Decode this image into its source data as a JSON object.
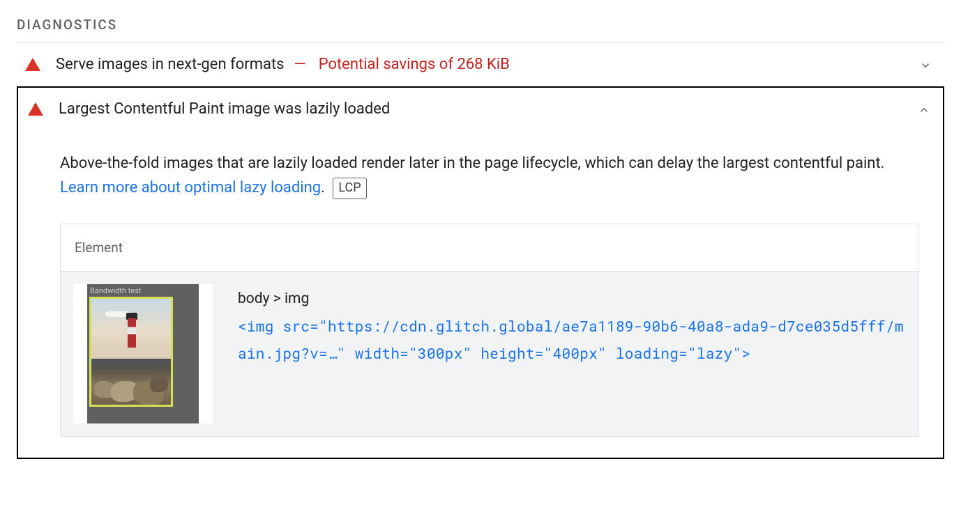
{
  "section": {
    "heading": "DIAGNOSTICS"
  },
  "audits": [
    {
      "title": "Serve images in next-gen formats",
      "savings": "Potential savings of 268 KiB",
      "expanded": false
    },
    {
      "title": "Largest Contentful Paint image was lazily loaded",
      "expanded": true
    }
  ],
  "expanded_detail": {
    "description_part1": "Above-the-fold images that are lazily loaded render later in the page lifecycle, which can delay the largest contentful paint. ",
    "learn_more": "Learn more about optimal lazy loading",
    "period": ".",
    "tag": "LCP",
    "element_header": "Element",
    "thumbnail_label": "Bandwidth test",
    "selector": "body > img",
    "snippet": "<img src=\"https://cdn.glitch.global/ae7a1189-90b6-40a8-ada9-d7ce035d5fff/main.jpg?v=…\" width=\"300px\" height=\"400px\" loading=\"lazy\">"
  }
}
